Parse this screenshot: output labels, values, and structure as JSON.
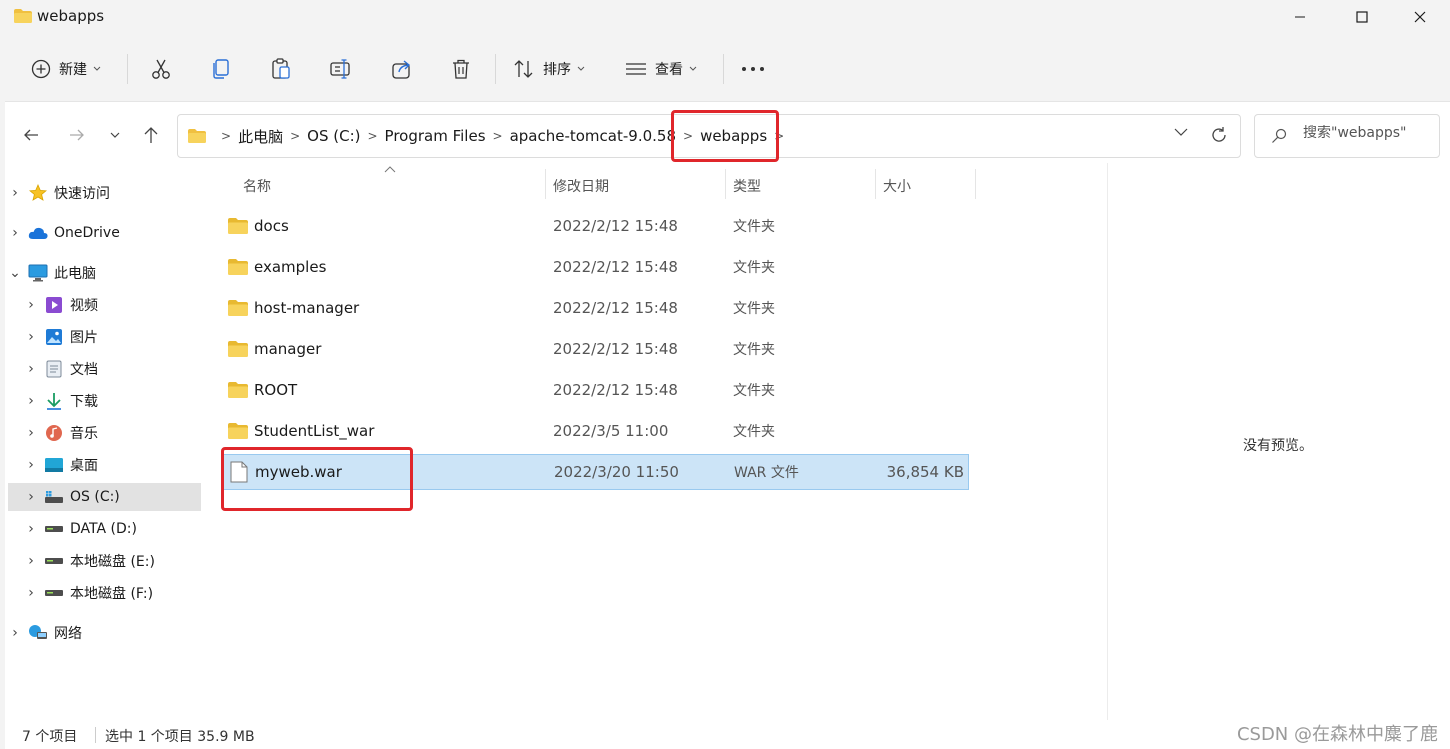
{
  "window": {
    "title": "webapps"
  },
  "toolbar": {
    "new_label": "新建",
    "sort_label": "排序",
    "view_label": "查看",
    "more_label": "•••"
  },
  "address": {
    "crumbs": [
      "此电脑",
      "OS (C:)",
      "Program Files",
      "apache-tomcat-9.0.58",
      "webapps"
    ],
    "search_placeholder": "搜索\"webapps\""
  },
  "sidebar": {
    "items": [
      {
        "label": "快速访问",
        "icon": "star-icon"
      },
      {
        "label": "OneDrive",
        "icon": "cloud-icon"
      },
      {
        "label": "此电脑",
        "icon": "monitor-icon"
      },
      {
        "label": "视频",
        "icon": "video-icon"
      },
      {
        "label": "图片",
        "icon": "picture-icon"
      },
      {
        "label": "文档",
        "icon": "document-icon"
      },
      {
        "label": "下载",
        "icon": "download-icon"
      },
      {
        "label": "音乐",
        "icon": "music-icon"
      },
      {
        "label": "桌面",
        "icon": "desktop-icon"
      },
      {
        "label": "OS (C:)",
        "icon": "drive-icon"
      },
      {
        "label": "DATA (D:)",
        "icon": "drive-icon"
      },
      {
        "label": "本地磁盘 (E:)",
        "icon": "drive-icon"
      },
      {
        "label": "本地磁盘 (F:)",
        "icon": "drive-icon"
      },
      {
        "label": "网络",
        "icon": "network-icon"
      }
    ]
  },
  "columns": {
    "name": "名称",
    "date": "修改日期",
    "type": "类型",
    "size": "大小"
  },
  "files": [
    {
      "name": "docs",
      "date": "2022/2/12 15:48",
      "type": "文件夹",
      "size": ""
    },
    {
      "name": "examples",
      "date": "2022/2/12 15:48",
      "type": "文件夹",
      "size": ""
    },
    {
      "name": "host-manager",
      "date": "2022/2/12 15:48",
      "type": "文件夹",
      "size": ""
    },
    {
      "name": "manager",
      "date": "2022/2/12 15:48",
      "type": "文件夹",
      "size": ""
    },
    {
      "name": "ROOT",
      "date": "2022/2/12 15:48",
      "type": "文件夹",
      "size": ""
    },
    {
      "name": "StudentList_war",
      "date": "2022/3/5 11:00",
      "type": "文件夹",
      "size": ""
    },
    {
      "name": "myweb.war",
      "date": "2022/3/20 11:50",
      "type": "WAR 文件",
      "size": "36,854 KB"
    }
  ],
  "preview": {
    "text": "没有预览。"
  },
  "status": {
    "count": "7 个项目",
    "selection": "选中 1 个项目  35.9 MB"
  },
  "watermark": "CSDN @在森林中麋了鹿",
  "colors": {
    "folder": "#f0c040",
    "selection": "#cce4f7",
    "highlight": "#e0262b"
  }
}
